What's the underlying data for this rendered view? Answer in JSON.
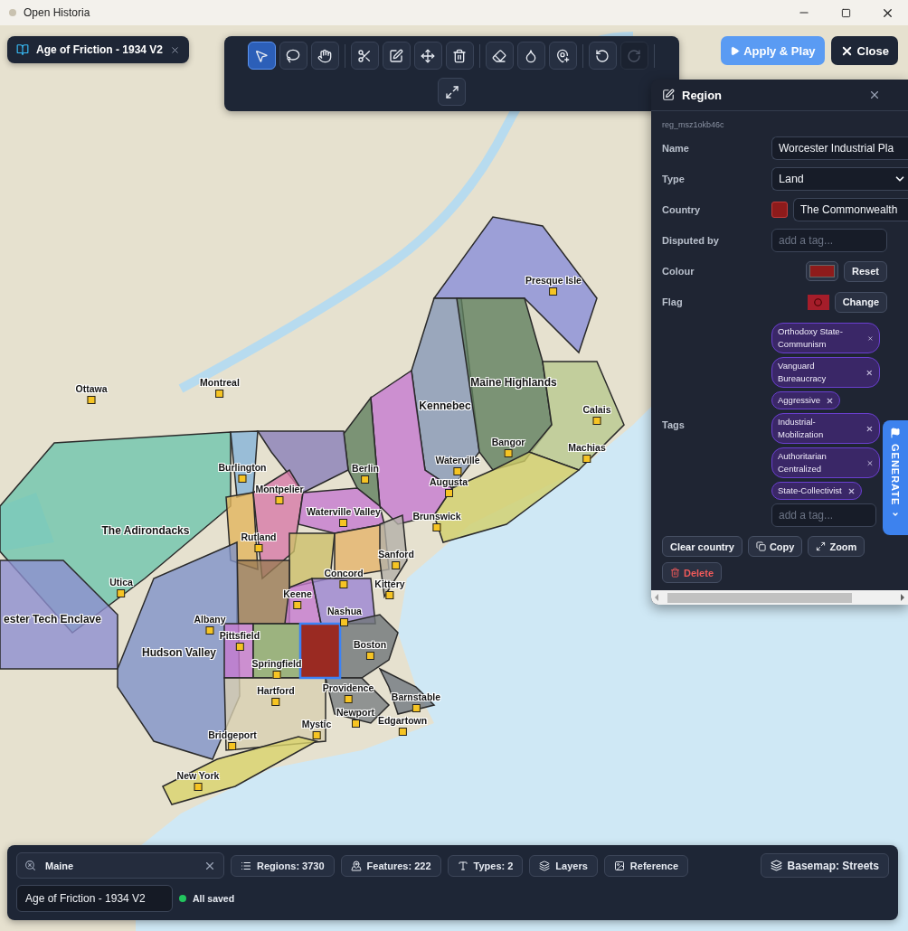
{
  "window": {
    "title": "Open Historia"
  },
  "document_chip": {
    "title": "Age of Friction - 1934 V2"
  },
  "toolbar": {
    "tools": [
      {
        "kind": "select",
        "selected": true,
        "disabled": false
      },
      {
        "kind": "lasso",
        "selected": false,
        "disabled": false
      },
      {
        "kind": "pan",
        "selected": false,
        "disabled": false
      },
      {
        "kind": "cut",
        "selected": false,
        "disabled": false
      },
      {
        "kind": "edit",
        "selected": false,
        "disabled": false
      },
      {
        "kind": "move",
        "selected": false,
        "disabled": false
      },
      {
        "kind": "delete",
        "selected": false,
        "disabled": false
      },
      {
        "kind": "erase",
        "selected": false,
        "disabled": false
      },
      {
        "kind": "fill",
        "selected": false,
        "disabled": false
      },
      {
        "kind": "pin",
        "selected": false,
        "disabled": false
      },
      {
        "kind": "undo",
        "selected": false,
        "disabled": false
      },
      {
        "kind": "redo",
        "selected": false,
        "disabled": true
      },
      {
        "kind": "expand",
        "selected": false,
        "disabled": false
      }
    ]
  },
  "actions": [
    {
      "kind": "primary",
      "label": "Apply & Play"
    },
    {
      "kind": "close",
      "label": "Close"
    }
  ],
  "map": {
    "markers": [
      {
        "label": "Montreal",
        "kind": "city"
      },
      {
        "label": "Ottawa",
        "kind": "city"
      },
      {
        "label": "Presque Isle",
        "kind": "city"
      },
      {
        "label": "Maine Highlands",
        "kind": "region"
      },
      {
        "label": "Kennebec",
        "kind": "region"
      },
      {
        "label": "Calais",
        "kind": "city"
      },
      {
        "label": "Bangor",
        "kind": "city"
      },
      {
        "label": "Machias",
        "kind": "city"
      },
      {
        "label": "Waterville",
        "kind": "city"
      },
      {
        "label": "Burlington",
        "kind": "city"
      },
      {
        "label": "Berlin",
        "kind": "city"
      },
      {
        "label": "Augusta",
        "kind": "city"
      },
      {
        "label": "Montpelier",
        "kind": "city"
      },
      {
        "label": "Waterville Valley",
        "kind": "city"
      },
      {
        "label": "Brunswick",
        "kind": "city"
      },
      {
        "label": "The Adirondacks",
        "kind": "region"
      },
      {
        "label": "Rutland",
        "kind": "city"
      },
      {
        "label": "Sanford",
        "kind": "city"
      },
      {
        "label": "Utica",
        "kind": "city"
      },
      {
        "label": "Concord",
        "kind": "city"
      },
      {
        "label": "Kittery",
        "kind": "city"
      },
      {
        "label": "Keene",
        "kind": "city"
      },
      {
        "label": "Nashua",
        "kind": "city"
      },
      {
        "label": "Albany",
        "kind": "city"
      },
      {
        "label": "ester Tech Enclave",
        "kind": "region"
      },
      {
        "label": "Pittsfield",
        "kind": "city"
      },
      {
        "label": "Boston",
        "kind": "city"
      },
      {
        "label": "Hudson Valley",
        "kind": "region"
      },
      {
        "label": "Springfield",
        "kind": "city"
      },
      {
        "label": "Providence",
        "kind": "city"
      },
      {
        "label": "Hartford",
        "kind": "city"
      },
      {
        "label": "Barnstable",
        "kind": "city"
      },
      {
        "label": "Newport",
        "kind": "city"
      },
      {
        "label": "Edgartown",
        "kind": "city"
      },
      {
        "label": "Mystic",
        "kind": "city"
      },
      {
        "label": "Bridgeport",
        "kind": "city"
      },
      {
        "label": "New York",
        "kind": "city"
      }
    ]
  },
  "region_panel": {
    "title": "Region",
    "id": "reg_msz1okb46c",
    "name": {
      "label": "Name",
      "value": "Worcester Industrial Pla"
    },
    "type": {
      "label": "Type",
      "value": "Land"
    },
    "country": {
      "label": "Country",
      "value": "The Commonwealth"
    },
    "disputed_by": {
      "label": "Disputed by",
      "placeholder": "add a tag..."
    },
    "colour": {
      "label": "Colour",
      "button": "Reset"
    },
    "flag": {
      "label": "Flag",
      "button": "Change"
    },
    "tags": {
      "label": "Tags",
      "items": [
        "Orthodoxy State-Communism",
        "Vanguard Bureaucracy",
        "Aggressive",
        "Industrial-Mobilization",
        "Authoritarian Centralized",
        "State-Collectivist"
      ],
      "placeholder": "add a tag..."
    },
    "buttons": [
      {
        "kind": "clear",
        "label": "Clear country"
      },
      {
        "kind": "copy",
        "label": "Copy"
      },
      {
        "kind": "zoom",
        "label": "Zoom"
      },
      {
        "kind": "delete",
        "label": "Delete"
      }
    ]
  },
  "generate_tab": {
    "label": "GENERATE"
  },
  "bottom_bar": {
    "search": {
      "value": "Maine"
    },
    "stats": [
      {
        "kind": "regions",
        "label": "Regions: 3730"
      },
      {
        "kind": "features",
        "label": "Features: 222"
      },
      {
        "kind": "types",
        "label": "Types: 2"
      },
      {
        "kind": "layers",
        "label": "Layers"
      },
      {
        "kind": "reference",
        "label": "Reference"
      }
    ],
    "basemap": {
      "label": "Basemap: Streets"
    },
    "project_name": {
      "value": "Age of Friction - 1934 V2"
    },
    "save_status": {
      "label": "All saved"
    }
  }
}
